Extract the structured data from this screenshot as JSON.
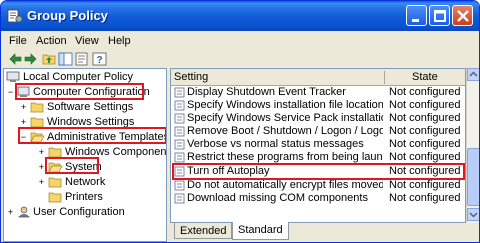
{
  "window": {
    "title": "Group Policy"
  },
  "menubar": {
    "items": [
      "File",
      "Action",
      "View",
      "Help"
    ]
  },
  "toolbar": {
    "icons": [
      "back-arrow-icon",
      "forward-arrow-icon",
      "up-folder-icon",
      "show-tree-icon",
      "properties-icon",
      "help-icon"
    ]
  },
  "tree": {
    "root": "Local Computer Policy",
    "computer_configuration": "Computer Configuration",
    "software_settings": "Software Settings",
    "windows_settings": "Windows Settings",
    "administrative_templates": "Administrative Templates",
    "windows_components": "Windows Components",
    "system": "System",
    "network": "Network",
    "printers": "Printers",
    "user_configuration": "User Configuration"
  },
  "list": {
    "columns": {
      "setting": "Setting",
      "state": "State"
    },
    "rows": [
      {
        "name": "Display Shutdown Event Tracker",
        "state": "Not configured"
      },
      {
        "name": "Specify Windows installation file location",
        "state": "Not configured"
      },
      {
        "name": "Specify Windows Service Pack installation ...",
        "state": "Not configured"
      },
      {
        "name": "Remove Boot / Shutdown / Logon / Logoff...",
        "state": "Not configured"
      },
      {
        "name": "Verbose vs normal status messages",
        "state": "Not configured"
      },
      {
        "name": "Restrict these programs from being launc...",
        "state": "Not configured"
      },
      {
        "name": "Turn off Autoplay",
        "state": "Not configured"
      },
      {
        "name": "Do not automatically encrypt files moved ...",
        "state": "Not configured"
      },
      {
        "name": "Download missing COM components",
        "state": "Not configured"
      }
    ]
  },
  "tabs": [
    "Extended",
    "Standard"
  ],
  "colors": {
    "titlebar": "#0a52cf",
    "highlight_red": "#e0171d",
    "folder_yellow": "#f5d46a"
  }
}
